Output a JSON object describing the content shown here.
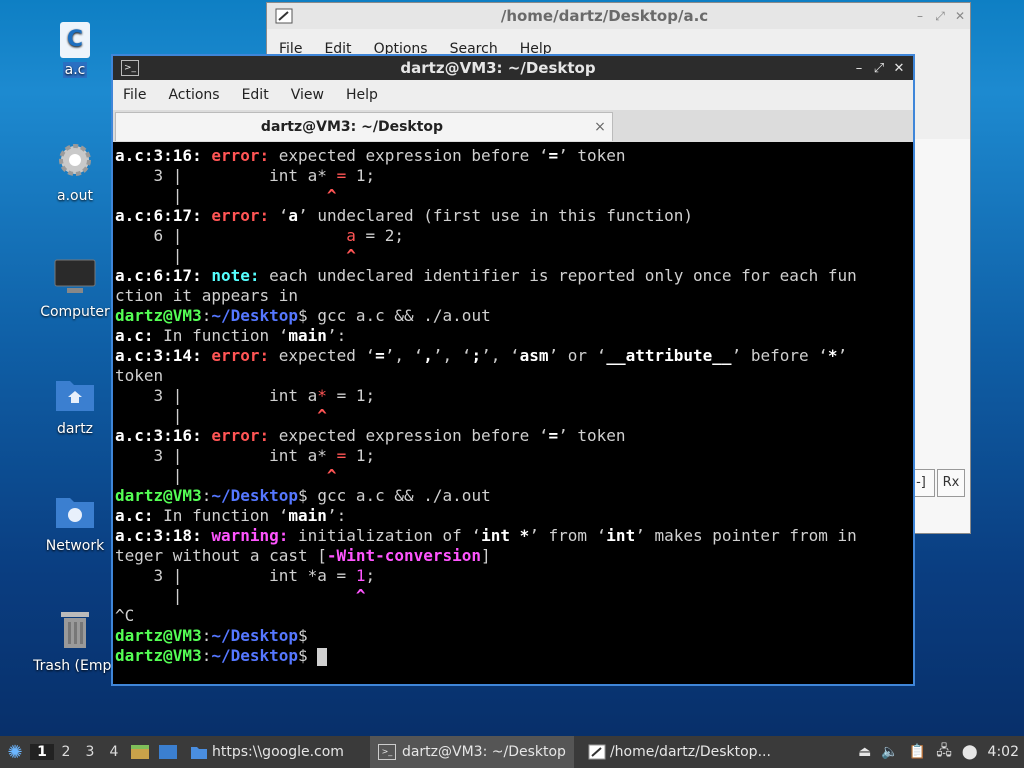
{
  "desktop": {
    "icons": [
      {
        "label": "a.c",
        "glyph": "C"
      },
      {
        "label": "a.out"
      },
      {
        "label": "Computer"
      },
      {
        "label": "dartz"
      },
      {
        "label": "Network"
      },
      {
        "label": "Trash (Empt"
      }
    ]
  },
  "editor_window": {
    "title": "/home/dartz/Desktop/a.c",
    "menu": [
      "File",
      "Edit",
      "Options",
      "Search",
      "Help"
    ],
    "buttons": [
      "-]",
      "Rx"
    ]
  },
  "terminal_window": {
    "title": "dartz@VM3: ~/Desktop",
    "menu": [
      "File",
      "Actions",
      "Edit",
      "View",
      "Help"
    ],
    "tab_title": "dartz@VM3: ~/Desktop",
    "tab_close": "×",
    "lines": [
      [
        [
          "c-file",
          "a.c:3:16: "
        ],
        [
          "c-err",
          "error: "
        ],
        [
          "",
          "expected expression before ‘"
        ],
        [
          "c-b",
          "="
        ],
        [
          "",
          "’ token"
        ]
      ],
      [
        [
          "",
          "    3 |         int a* "
        ],
        [
          "c-red",
          "="
        ],
        [
          "",
          " 1;"
        ]
      ],
      [
        [
          "",
          "      |               "
        ],
        [
          "c-redb",
          "^"
        ]
      ],
      [
        [
          "c-file",
          "a.c:6:17: "
        ],
        [
          "c-err",
          "error: "
        ],
        [
          "",
          "‘"
        ],
        [
          "c-b",
          "a"
        ],
        [
          "",
          "’ undeclared (first use in this function)"
        ]
      ],
      [
        [
          "",
          "    6 |                 "
        ],
        [
          "c-red",
          "a"
        ],
        [
          "",
          " = 2;"
        ]
      ],
      [
        [
          "",
          "      |                 "
        ],
        [
          "c-redb",
          "^"
        ]
      ],
      [
        [
          "c-file",
          "a.c:6:17: "
        ],
        [
          "c-note",
          "note: "
        ],
        [
          "",
          "each undeclared identifier is reported only once for each fun"
        ]
      ],
      [
        [
          "",
          "ction it appears in"
        ]
      ],
      [
        [
          "c-user",
          "dartz@VM3"
        ],
        [
          "",
          ":"
        ],
        [
          "c-path",
          "~/Desktop"
        ],
        [
          "",
          "$ gcc a.c && ./a.out"
        ]
      ],
      [
        [
          "c-file",
          "a.c: "
        ],
        [
          "",
          "In function ‘"
        ],
        [
          "c-b",
          "main"
        ],
        [
          "",
          "’:"
        ]
      ],
      [
        [
          "c-file",
          "a.c:3:14: "
        ],
        [
          "c-err",
          "error: "
        ],
        [
          "",
          "expected ‘"
        ],
        [
          "c-b",
          "="
        ],
        [
          "",
          "’, ‘"
        ],
        [
          "c-b",
          ","
        ],
        [
          "",
          "’, ‘"
        ],
        [
          "c-b",
          ";"
        ],
        [
          "",
          "’, ‘"
        ],
        [
          "c-b",
          "asm"
        ],
        [
          "",
          "’ or ‘"
        ],
        [
          "c-b",
          "__attribute__"
        ],
        [
          "",
          "’ before ‘"
        ],
        [
          "c-b",
          "*"
        ],
        [
          "",
          "’"
        ]
      ],
      [
        [
          "",
          "token"
        ]
      ],
      [
        [
          "",
          "    3 |         int a"
        ],
        [
          "c-red",
          "*"
        ],
        [
          "",
          " = 1;"
        ]
      ],
      [
        [
          "",
          "      |              "
        ],
        [
          "c-redb",
          "^"
        ]
      ],
      [
        [
          "c-file",
          "a.c:3:16: "
        ],
        [
          "c-err",
          "error: "
        ],
        [
          "",
          "expected expression before ‘"
        ],
        [
          "c-b",
          "="
        ],
        [
          "",
          "’ token"
        ]
      ],
      [
        [
          "",
          "    3 |         int a* "
        ],
        [
          "c-red",
          "="
        ],
        [
          "",
          " 1;"
        ]
      ],
      [
        [
          "",
          "      |               "
        ],
        [
          "c-redb",
          "^"
        ]
      ],
      [
        [
          "c-user",
          "dartz@VM3"
        ],
        [
          "",
          ":"
        ],
        [
          "c-path",
          "~/Desktop"
        ],
        [
          "",
          "$ gcc a.c && ./a.out"
        ]
      ],
      [
        [
          "c-file",
          "a.c: "
        ],
        [
          "",
          "In function ‘"
        ],
        [
          "c-b",
          "main"
        ],
        [
          "",
          "’:"
        ]
      ],
      [
        [
          "c-file",
          "a.c:3:18: "
        ],
        [
          "c-warn",
          "warning: "
        ],
        [
          "",
          "initialization of ‘"
        ],
        [
          "c-b",
          "int *"
        ],
        [
          "",
          "’ from ‘"
        ],
        [
          "c-b",
          "int"
        ],
        [
          "",
          "’ makes pointer from in"
        ]
      ],
      [
        [
          "",
          "teger without a cast ["
        ],
        [
          "c-magb",
          "-Wint-conversion"
        ],
        [
          "",
          "]"
        ]
      ],
      [
        [
          "",
          "    3 |         int *a = "
        ],
        [
          "c-mag",
          "1"
        ],
        [
          "",
          ";"
        ]
      ],
      [
        [
          "",
          "      |                  "
        ],
        [
          "c-magb",
          "^"
        ]
      ],
      [
        [
          "",
          "^C"
        ]
      ],
      [
        [
          "c-user",
          "dartz@VM3"
        ],
        [
          "",
          ":"
        ],
        [
          "c-path",
          "~/Desktop"
        ],
        [
          "",
          "$"
        ]
      ],
      [
        [
          "c-user",
          "dartz@VM3"
        ],
        [
          "",
          ":"
        ],
        [
          "c-path",
          "~/Desktop"
        ],
        [
          "",
          "$ "
        ]
      ]
    ]
  },
  "taskbar": {
    "workspaces": [
      "1",
      "2",
      "3",
      "4"
    ],
    "active_workspace": "1",
    "tasks": [
      {
        "label": "https:\\\\google.com"
      },
      {
        "label": "dartz@VM3: ~/Desktop"
      },
      {
        "label": "/home/dartz/Desktop..."
      }
    ],
    "clock": "4:02"
  }
}
